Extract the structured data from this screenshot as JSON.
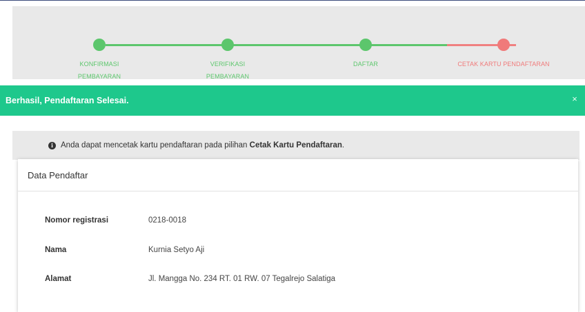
{
  "stepper": {
    "steps": [
      {
        "label_line1": "KONFIRMASI",
        "label_line2": "PEMBAYARAN",
        "status": "done"
      },
      {
        "label_line1": "VERIFIKASI",
        "label_line2": "PEMBAYARAN",
        "status": "done"
      },
      {
        "label_line1": "DAFTAR",
        "label_line2": "",
        "status": "done"
      },
      {
        "label_line1": "CETAK KARTU PENDAFTARAN",
        "label_line2": "",
        "status": "current"
      }
    ],
    "colors": {
      "done": "#5cc66c",
      "current": "#f07a7a"
    }
  },
  "alert": {
    "message": "Berhasil, Pendaftaran Selesai.",
    "close_glyph": "×",
    "color": "#1ec88c"
  },
  "info": {
    "icon": "info-circle-icon",
    "icon_glyph": "i",
    "text_prefix": "Anda dapat mencetak kartu pendaftaran pada pilihan ",
    "text_bold": "Cetak Kartu Pendaftaran",
    "text_suffix": "."
  },
  "card": {
    "title": "Data Pendaftar",
    "fields": [
      {
        "label": "Nomor registrasi",
        "value": "0218-0018"
      },
      {
        "label": "Nama",
        "value": "Kurnia Setyo Aji"
      },
      {
        "label": "Alamat",
        "value": "Jl. Mangga No. 234 RT. 01 RW. 07 Tegalrejo Salatiga"
      }
    ]
  }
}
